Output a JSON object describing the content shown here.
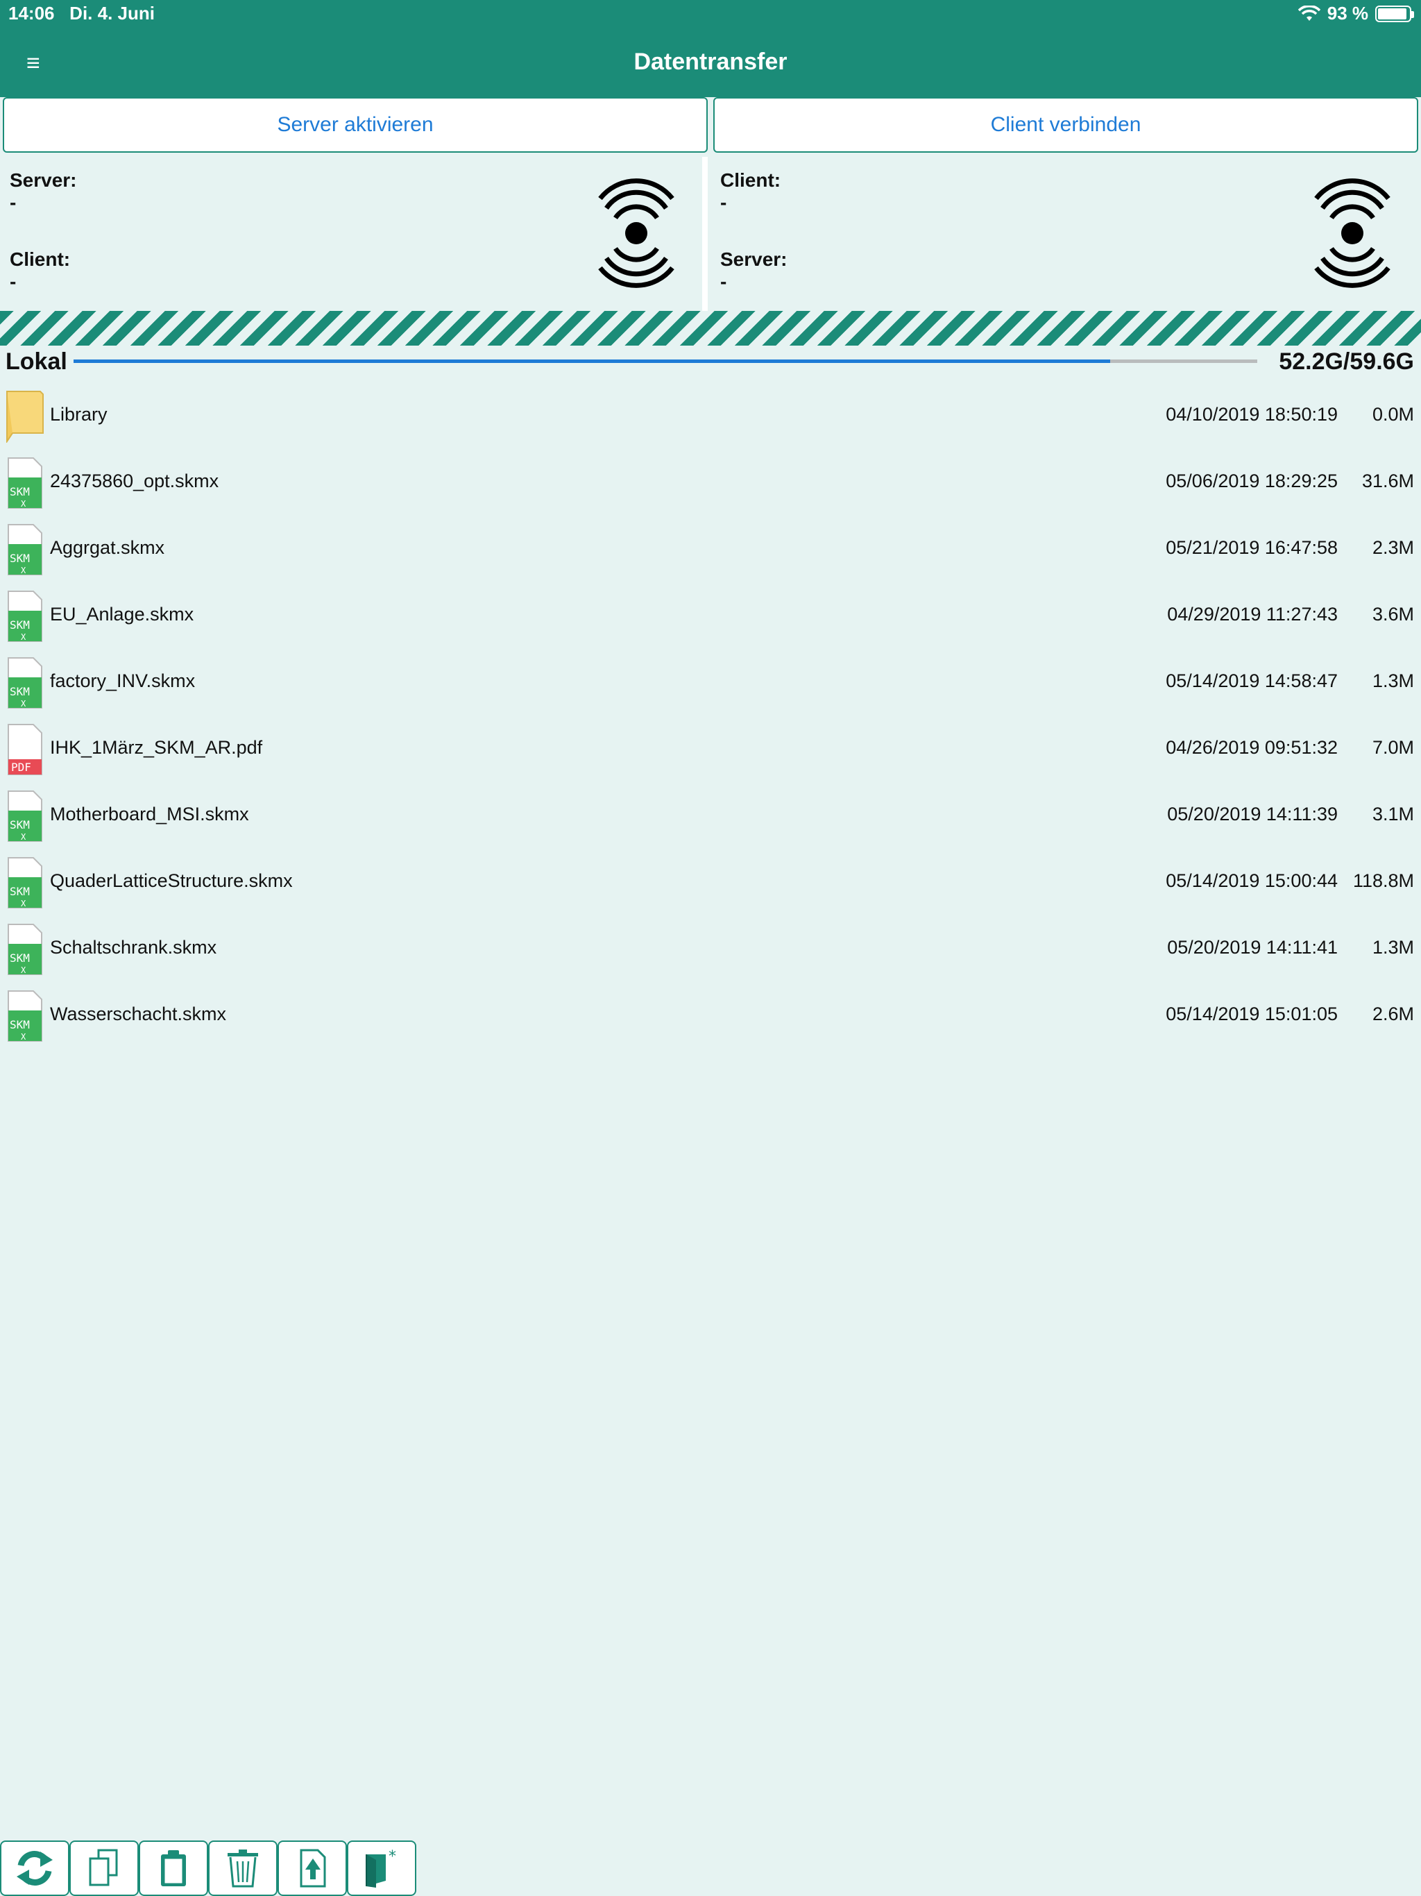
{
  "status": {
    "time": "14:06",
    "date": "Di. 4. Juni",
    "battery": "93 %",
    "battery_level": 0.93
  },
  "header": {
    "menu_icon": "≡",
    "title": "Datentransfer"
  },
  "actions": {
    "server_label": "Server aktivieren",
    "client_label": "Client verbinden"
  },
  "server_panel": {
    "server_label": "Server:",
    "server_value": "-",
    "client_label": "Client:",
    "client_value": "-"
  },
  "client_panel": {
    "client_label": "Client:",
    "client_value": "-",
    "server_label": "Server:",
    "server_value": "-"
  },
  "storage": {
    "label": "Lokal",
    "used": "52.2G/59.6G",
    "used_fraction": 0.8758
  },
  "files": [
    {
      "name": "Library",
      "date": "04/10/2019 18:50:19",
      "size": "0.0M",
      "type": "folder"
    },
    {
      "name": "24375860_opt.skmx",
      "date": "05/06/2019 18:29:25",
      "size": "31.6M",
      "type": "skm"
    },
    {
      "name": "Aggrgat.skmx",
      "date": "05/21/2019 16:47:58",
      "size": "2.3M",
      "type": "skm"
    },
    {
      "name": "EU_Anlage.skmx",
      "date": "04/29/2019 11:27:43",
      "size": "3.6M",
      "type": "skm"
    },
    {
      "name": "factory_INV.skmx",
      "date": "05/14/2019 14:58:47",
      "size": "1.3M",
      "type": "skm"
    },
    {
      "name": "IHK_1März_SKM_AR.pdf",
      "date": "04/26/2019 09:51:32",
      "size": "7.0M",
      "type": "pdf"
    },
    {
      "name": "Motherboard_MSI.skmx",
      "date": "05/20/2019 14:11:39",
      "size": "3.1M",
      "type": "skm"
    },
    {
      "name": "QuaderLatticeStructure.skmx",
      "date": "05/14/2019 15:00:44",
      "size": "118.8M",
      "type": "skm"
    },
    {
      "name": "Schaltschrank.skmx",
      "date": "05/20/2019 14:11:41",
      "size": "1.3M",
      "type": "skm"
    },
    {
      "name": "Wasserschacht.skmx",
      "date": "05/14/2019 15:01:05",
      "size": "2.6M",
      "type": "skm"
    }
  ],
  "toolbar": [
    {
      "icon": "refresh-icon"
    },
    {
      "icon": "copy-icon"
    },
    {
      "icon": "paste-icon"
    },
    {
      "icon": "trash-icon"
    },
    {
      "icon": "upload-icon"
    },
    {
      "icon": "new-folder-icon"
    }
  ],
  "colors": {
    "accent": "#1b8c78",
    "link": "#1e7bd6",
    "background": "#e6f3f2"
  }
}
